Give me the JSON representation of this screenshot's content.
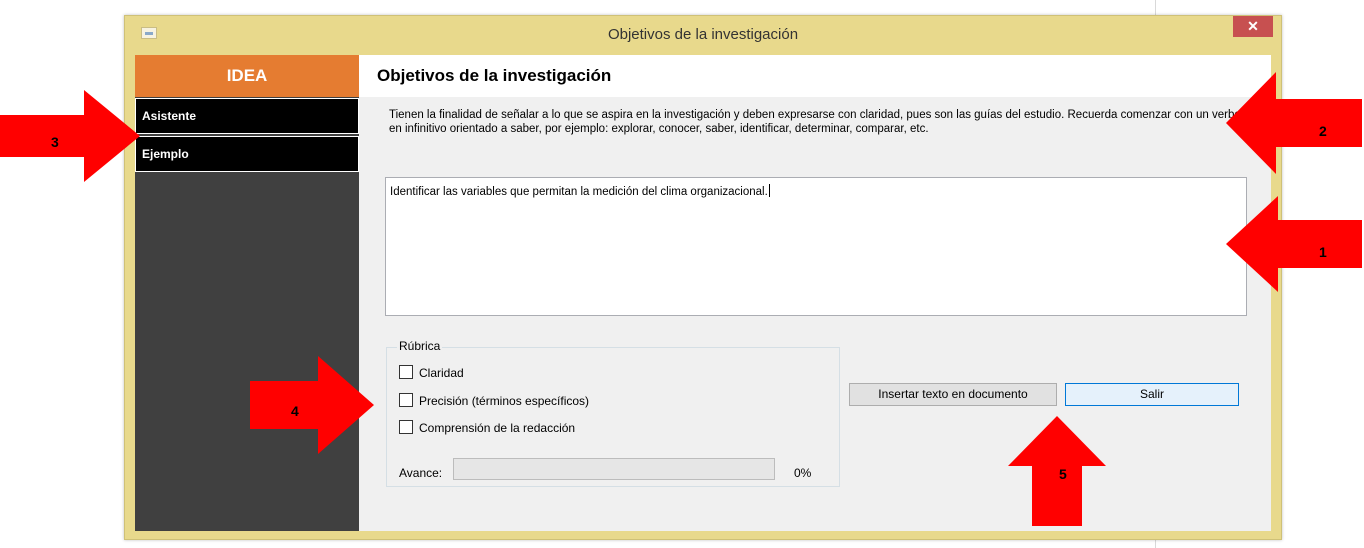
{
  "window": {
    "title": "Objetivos de la investigación",
    "close_glyph": "✕"
  },
  "sidebar": {
    "header": "IDEA",
    "items": [
      {
        "label": "Asistente"
      },
      {
        "label": "Ejemplo"
      }
    ]
  },
  "main": {
    "heading": "Objetivos de la investigación",
    "instructions": "Tienen la finalidad de señalar a lo que se aspira en la investigación y deben expresarse con claridad, pues son las guías del estudio. Recuerda comenzar con un verbo en infinitivo orientado a saber, por ejemplo: explorar, conocer, saber, identificar, determinar, comparar, etc.",
    "answer_text": "Identificar las variables que permitan la medición del clima organizacional."
  },
  "rubric": {
    "legend": "Rúbrica",
    "criteria": [
      {
        "label": "Claridad",
        "checked": false
      },
      {
        "label": "Precisión (términos específicos)",
        "checked": false
      },
      {
        "label": "Comprensión de la redacción",
        "checked": false
      }
    ],
    "progress_label": "Avance:",
    "progress_value": 0,
    "progress_text": "0%"
  },
  "actions": {
    "insert_label": "Insertar texto en documento",
    "exit_label": "Salir"
  },
  "callouts": [
    {
      "number": "1"
    },
    {
      "number": "2"
    },
    {
      "number": "3"
    },
    {
      "number": "4"
    },
    {
      "number": "5"
    }
  ],
  "colors": {
    "window_frame": "#e8d98c",
    "sidebar_header": "#e57c31",
    "sidebar_bg": "#404040",
    "close_button": "#c75050",
    "callout_arrow": "#ff0000"
  }
}
